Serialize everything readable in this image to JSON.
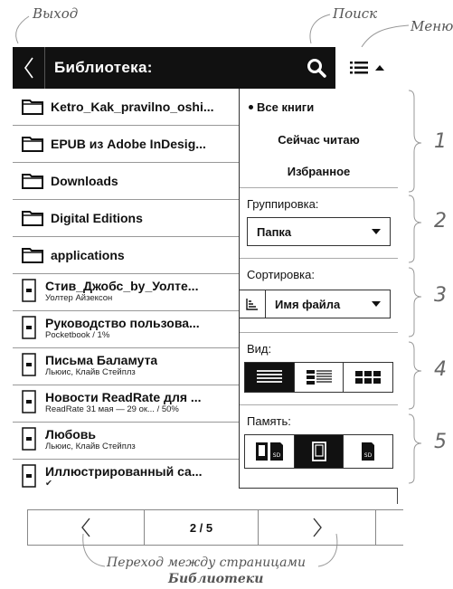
{
  "callouts": {
    "exit": "Выход",
    "search": "Поиск",
    "menu": "Меню",
    "pager_line1": "Переход между страницами",
    "pager_line2": "Библиотеки",
    "n1": "1",
    "n2": "2",
    "n3": "3",
    "n4": "4",
    "n5": "5"
  },
  "header": {
    "title": "Библиотека:"
  },
  "folders": [
    {
      "name": "Ketro_Kak_pravilno_oshi..."
    },
    {
      "name": "EPUB из Adobe InDesig..."
    },
    {
      "name": "Downloads"
    },
    {
      "name": "Digital Editions"
    },
    {
      "name": "applications"
    }
  ],
  "books": [
    {
      "title": "Стив_Джобс_by_Уолте...",
      "sub": "Уолтер Айзексон"
    },
    {
      "title": "Руководство пользова...",
      "sub": "Pocketbook / 1%"
    },
    {
      "title": "Письма Баламута",
      "sub": "Льюис, Клайв Стейплз"
    },
    {
      "title": "Новости ReadRate для ...",
      "sub": "ReadRate 31 мая — 29 ок... / 50%"
    },
    {
      "title": "Любовь",
      "sub": "Льюис, Клайв Стейплз"
    },
    {
      "title": "Иллюстрированный са...",
      "sub": "✔"
    }
  ],
  "menu": {
    "filters": {
      "all": "Все книги",
      "reading": "Сейчас читаю",
      "favorites": "Избранное"
    },
    "grouping": {
      "label": "Группировка:",
      "value": "Папка"
    },
    "sorting": {
      "label": "Сортировка:",
      "value": "Имя файла"
    },
    "view": {
      "label": "Вид:",
      "selected": "list"
    },
    "memory": {
      "label": "Память:",
      "selected": "internal"
    }
  },
  "pager": {
    "page": "2 / 5"
  }
}
